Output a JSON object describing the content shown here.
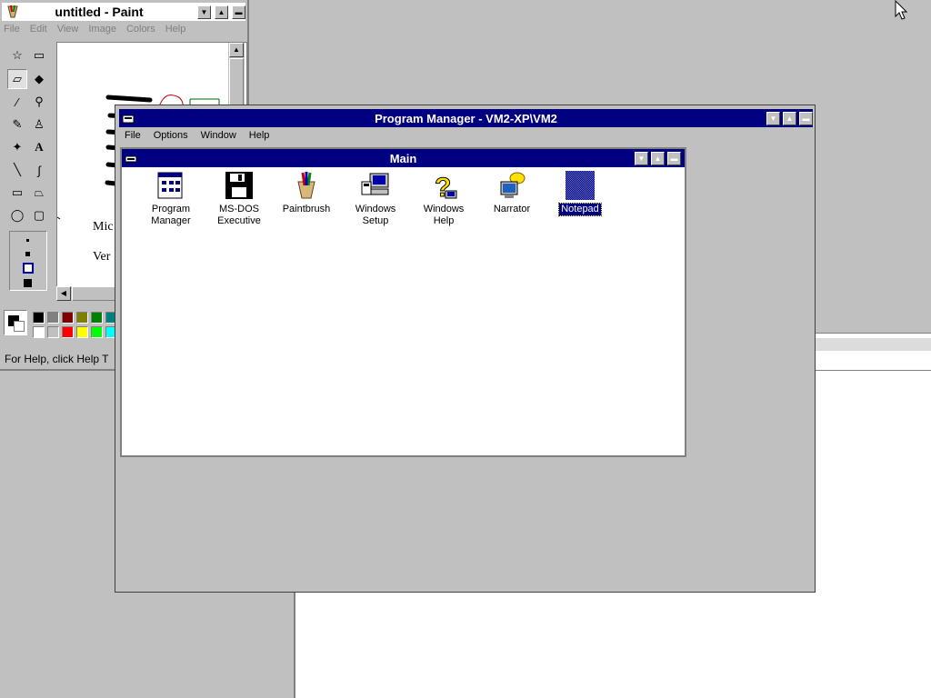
{
  "paint": {
    "title": "untitled - Paint",
    "menu": [
      "File",
      "Edit",
      "View",
      "Image",
      "Colors",
      "Help"
    ],
    "canvas_text": [
      "Mic",
      "Ver"
    ],
    "status": "For Help, click Help T",
    "palette": [
      "#000000",
      "#808080",
      "#800000",
      "#808000",
      "#008000",
      "#008080",
      "#ffffff",
      "#c0c0c0",
      "#ff0000",
      "#ffff00",
      "#00ff00",
      "#00ffff"
    ]
  },
  "program_manager": {
    "title": "Program Manager - VM2-XP\\VM2",
    "menu": [
      "File",
      "Options",
      "Window",
      "Help"
    ],
    "group": {
      "title": "Main",
      "icons": [
        {
          "line1": "Program",
          "line2": "Manager",
          "icon": "program-manager-icon"
        },
        {
          "line1": "MS-DOS",
          "line2": "Executive",
          "icon": "ms-dos-executive-icon"
        },
        {
          "line1": "Paintbrush",
          "line2": "",
          "icon": "paintbrush-icon"
        },
        {
          "line1": "Windows",
          "line2": "Setup",
          "icon": "windows-setup-icon"
        },
        {
          "line1": "Windows",
          "line2": "Help",
          "icon": "windows-help-icon"
        },
        {
          "line1": "Narrator",
          "line2": "",
          "icon": "narrator-icon"
        },
        {
          "line1": "Notepad",
          "line2": "",
          "icon": "notepad-icon",
          "selected": true
        }
      ]
    }
  },
  "colors": {
    "title_active": "#000080",
    "window_bg": "#c0c0c0",
    "desktop": "#c0c0c0"
  }
}
